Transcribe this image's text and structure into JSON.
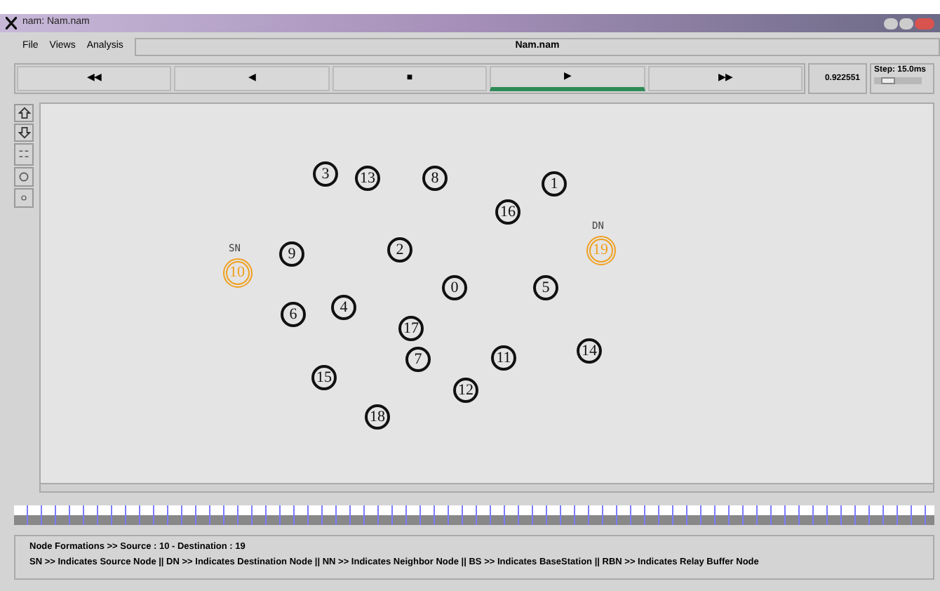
{
  "window": {
    "title": "nam: Nam.nam"
  },
  "menu": [
    {
      "label": "File"
    },
    {
      "label": "Views"
    },
    {
      "label": "Analysis"
    }
  ],
  "file_name": "Nam.nam",
  "transport": [
    {
      "label": "◀◀",
      "selected": false
    },
    {
      "label": "◀",
      "selected": false
    },
    {
      "label": "■",
      "selected": false
    },
    {
      "label": "▶",
      "selected": true
    },
    {
      "label": "▶▶",
      "selected": false
    }
  ],
  "time": "0.922551",
  "step": {
    "reading": "Step: 15.0ms",
    "level": 0.3
  },
  "nodes": [
    {
      "id": "3",
      "kind": "normal"
    },
    {
      "id": "13",
      "kind": "normal"
    },
    {
      "id": "8",
      "kind": "normal"
    },
    {
      "id": "1",
      "kind": "normal"
    },
    {
      "id": "16",
      "kind": "normal"
    },
    {
      "id": "10",
      "kind": "source",
      "label": "SN"
    },
    {
      "id": "9",
      "kind": "normal"
    },
    {
      "id": "2",
      "kind": "normal"
    },
    {
      "id": "19",
      "kind": "destination",
      "label": "DN"
    },
    {
      "id": "6",
      "kind": "normal"
    },
    {
      "id": "4",
      "kind": "normal"
    },
    {
      "id": "0",
      "kind": "normal"
    },
    {
      "id": "5",
      "kind": "normal"
    },
    {
      "id": "17",
      "kind": "normal"
    },
    {
      "id": "15",
      "kind": "normal"
    },
    {
      "id": "7",
      "kind": "normal"
    },
    {
      "id": "11",
      "kind": "normal"
    },
    {
      "id": "14",
      "kind": "normal"
    },
    {
      "id": "12",
      "kind": "normal"
    },
    {
      "id": "18",
      "kind": "normal"
    }
  ],
  "messages": [
    "Node Formations >> Source : 10 - Destination : 19",
    "SN >> Indicates Source Node || DN >> Indicates Destination Node || NN >> Indicates Neighbor Node || BS >> Indicates BaseStation || RBN >> Indicates Relay Buffer Node"
  ]
}
